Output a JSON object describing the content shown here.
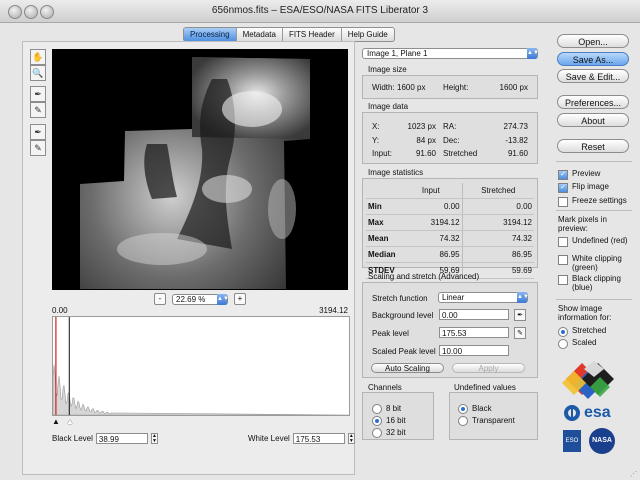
{
  "window": {
    "title": "656nmos.fits – ESA/ESO/NASA FITS Liberator 3"
  },
  "tabs": [
    {
      "label": "Processing",
      "active": true
    },
    {
      "label": "Metadata",
      "active": false
    },
    {
      "label": "FITS Header",
      "active": false
    },
    {
      "label": "Help Guide",
      "active": false
    }
  ],
  "tools": [
    "hand-icon",
    "magnifier-icon",
    "pick-black-icon",
    "pick-white-icon",
    "pick-bg-icon",
    "pick-peak-icon"
  ],
  "viewer": {
    "zoom": "22.69 %",
    "minus": "-",
    "plus": "+"
  },
  "histogram": {
    "min": "0.00",
    "max": "3194.12",
    "black_marker": 0.003,
    "white_marker": 0.055
  },
  "levels": {
    "black_label": "Black Level",
    "black_value": "38.99",
    "white_label": "White Level",
    "white_value": "175.53"
  },
  "plane_select": "Image 1, Plane 1",
  "image_size": {
    "heading": "Image size",
    "width_label": "Width:",
    "width_value": "1600 px",
    "height_label": "Height:",
    "height_value": "1600 px"
  },
  "image_data": {
    "heading": "Image data",
    "x_label": "X:",
    "x_value": "1023 px",
    "ra_label": "RA:",
    "ra_value": "274.73",
    "y_label": "Y:",
    "y_value": "84 px",
    "dec_label": "Dec:",
    "dec_value": "-13.82",
    "input_label": "Input:",
    "input_value": "91.60",
    "stretched_label": "Stretched",
    "stretched_value": "91.60"
  },
  "stats": {
    "heading": "Image statistics",
    "col_input": "Input",
    "col_stretched": "Stretched",
    "rows": [
      {
        "label": "Min",
        "input": "0.00",
        "stretched": "0.00"
      },
      {
        "label": "Max",
        "input": "3194.12",
        "stretched": "3194.12"
      },
      {
        "label": "Mean",
        "input": "74.32",
        "stretched": "74.32"
      },
      {
        "label": "Median",
        "input": "86.95",
        "stretched": "86.95"
      },
      {
        "label": "STDEV",
        "input": "59.69",
        "stretched": "59.69"
      }
    ]
  },
  "scaling": {
    "heading": "Scaling and stretch (Advanced)",
    "function_label": "Stretch function",
    "function_value": "Linear",
    "bg_label": "Background level",
    "bg_value": "0.00",
    "peak_label": "Peak level",
    "peak_value": "175.53",
    "scaled_peak_label": "Scaled Peak level",
    "scaled_peak_value": "10.00",
    "auto_button": "Auto Scaling",
    "apply_button": "Apply"
  },
  "channels": {
    "heading": "Channels",
    "options": [
      "8 bit",
      "16 bit",
      "32 bit"
    ],
    "selected": 1
  },
  "undefined_values": {
    "heading": "Undefined values",
    "options": [
      "Black",
      "Transparent"
    ],
    "selected": 0
  },
  "buttons": {
    "open": "Open...",
    "save_as": "Save As...",
    "save_edit": "Save & Edit...",
    "preferences": "Preferences...",
    "about": "About",
    "reset": "Reset"
  },
  "options": {
    "preview": "Preview",
    "flip": "Flip image",
    "freeze": "Freeze settings",
    "mark_heading": "Mark pixels in preview:",
    "undef_red": "Undefined (red)",
    "white_clip": "White clipping (green)",
    "black_clip": "Black clipping (blue)",
    "show_heading": "Show image information for:",
    "show_options": [
      "Stretched",
      "Scaled"
    ],
    "show_selected": 0
  },
  "logos": {
    "esa": "esa",
    "eso": "ESO",
    "nasa": "NASA"
  },
  "colors": {
    "accent": "#4f91e0",
    "black_marker": "#cc2222",
    "white_marker": "#111111"
  }
}
